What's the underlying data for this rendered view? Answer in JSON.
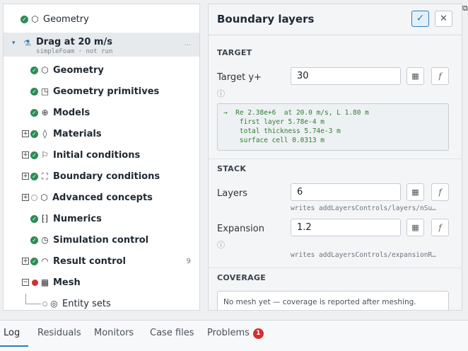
{
  "tree": {
    "top_item": {
      "label": "Geometry",
      "icon": "cube-icon"
    },
    "case": {
      "title": "Drag at 20 m/s",
      "subtitle": "simpleFoam · not run",
      "more": "..."
    },
    "items": [
      {
        "label": "Geometry",
        "icon": "cube-icon",
        "status": "ok"
      },
      {
        "label": "Geometry primitives",
        "icon": "shapes-icon",
        "status": "ok"
      },
      {
        "label": "Models",
        "icon": "globe-icon",
        "status": "ok"
      },
      {
        "label": "Materials",
        "icon": "droplet-icon",
        "status": "ok",
        "expandable": true
      },
      {
        "label": "Initial conditions",
        "icon": "flag-icon",
        "status": "ok",
        "expandable": true
      },
      {
        "label": "Boundary conditions",
        "icon": "boundary-icon",
        "status": "ok",
        "expandable": true
      },
      {
        "label": "Advanced concepts",
        "icon": "hexagon-icon",
        "status": "empty",
        "expandable": true
      },
      {
        "label": "Numerics",
        "icon": "numerics-icon",
        "status": "ok"
      },
      {
        "label": "Simulation control",
        "icon": "clock-icon",
        "status": "ok"
      },
      {
        "label": "Result control",
        "icon": "gauge-icon",
        "status": "ok",
        "expandable": true,
        "count": "9"
      },
      {
        "label": "Mesh",
        "icon": "grid-icon",
        "status": "error",
        "expandable": true,
        "expanded": true
      },
      {
        "label": "Entity sets",
        "icon": "target-icon",
        "status": "empty",
        "child": true
      }
    ]
  },
  "panel": {
    "title": "Boundary layers",
    "target_section": "TARGET",
    "target_label": "Target y+",
    "target_value": "30",
    "result_lines": "→  Re 2.38e+6  at 20.0 m/s, L 1.80 m\n    first layer 5.78e-4 m\n    total thickness 5.74e-3 m\n    surface cell 0.0313 m",
    "stack_section": "STACK",
    "layers_label": "Layers",
    "layers_value": "6",
    "layers_writes": "writes  addLayersControls/layers/nSu…",
    "expansion_label": "Expansion",
    "expansion_value": "1.2",
    "expansion_writes": "writes  addLayersControls/expansionR…",
    "coverage_section": "COVERAGE",
    "coverage_text": "No mesh yet — coverage is reported after meshing.",
    "fx_label": "f",
    "info_glyph": "ⓘ"
  },
  "bottom_tabs": {
    "log": "Log",
    "residuals": "Residuals",
    "monitors": "Monitors",
    "case_files": "Case files",
    "problems": "Problems",
    "problems_count": "1"
  },
  "colors": {
    "accent": "#2c7db8",
    "ok": "#2e8b57",
    "error": "#d32f2f"
  }
}
